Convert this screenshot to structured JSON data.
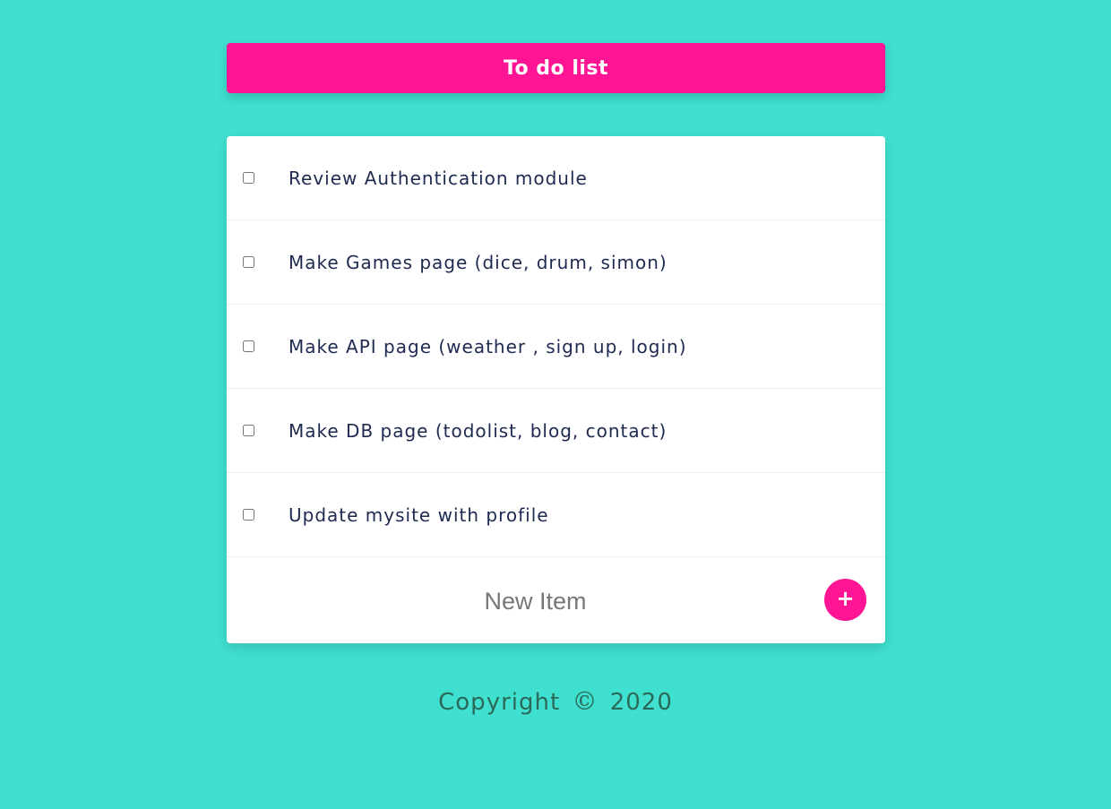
{
  "header": {
    "title": "To do list"
  },
  "items": [
    {
      "label": "Review Authentication module",
      "checked": false
    },
    {
      "label": "Make Games page (dice, drum, simon)",
      "checked": false
    },
    {
      "label": "Make API page (weather , sign up, login)",
      "checked": false
    },
    {
      "label": "Make DB page (todolist, blog, contact)",
      "checked": false
    },
    {
      "label": "Update mysite with profile",
      "checked": false
    }
  ],
  "new_item": {
    "placeholder": "New Item",
    "value": "",
    "add_label": "+"
  },
  "footer": {
    "prefix": "Copyright",
    "symbol": "©",
    "year": "2020"
  },
  "colors": {
    "background": "#40e0d0",
    "accent": "#ff1493",
    "text": "#1e2a4f",
    "footer_text": "#2b6a5a"
  }
}
